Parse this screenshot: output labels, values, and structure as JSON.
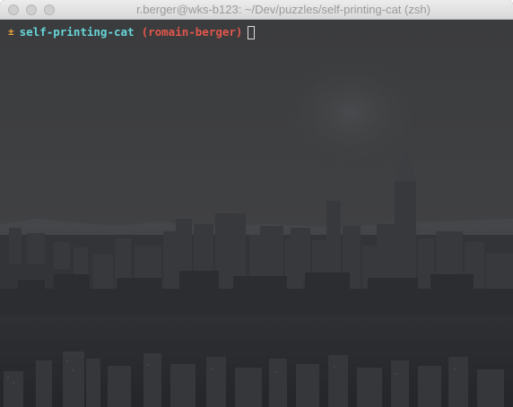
{
  "window": {
    "title": "r.berger@wks-b123: ~/Dev/puzzles/self-printing-cat (zsh)"
  },
  "terminal": {
    "prompt_glyph": "±",
    "directory": "self-printing-cat",
    "branch": "(romain-berger)",
    "background_image": "city skyline at dusk"
  },
  "colors": {
    "directory": "#67d6d8",
    "branch": "#e2574c",
    "prompt_glyph": "#e8a33a"
  }
}
